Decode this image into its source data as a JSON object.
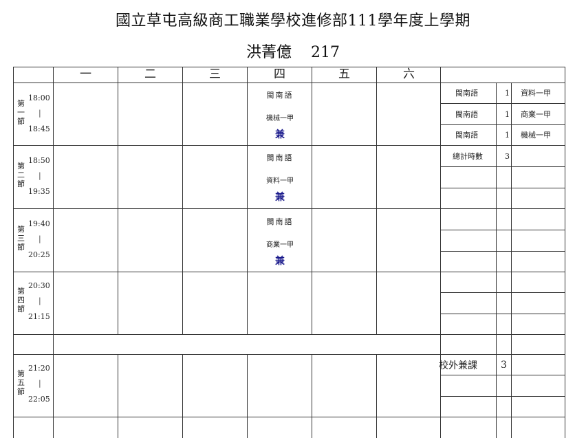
{
  "header": {
    "title": "國立草屯高級商工職業學校進修部111學年度上學期",
    "teacher": "洪菁億",
    "room": "217"
  },
  "days": [
    "一",
    "二",
    "三",
    "四",
    "五",
    "六"
  ],
  "periods": [
    {
      "chars": [
        "第",
        "一",
        "節"
      ],
      "start": "18:00",
      "end": "18:45"
    },
    {
      "chars": [
        "第",
        "二",
        "節"
      ],
      "start": "18:50",
      "end": "19:35"
    },
    {
      "chars": [
        "第",
        "三",
        "節"
      ],
      "start": "19:40",
      "end": "20:25"
    },
    {
      "chars": [
        "第",
        "四",
        "節"
      ],
      "start": "20:30",
      "end": "21:15"
    },
    {
      "chars": [
        "第",
        "五",
        "節"
      ],
      "start": "21:20",
      "end": "22:05"
    }
  ],
  "period_separator": "|",
  "courses": [
    {
      "period": 1,
      "day": "四",
      "subject": "閩南語",
      "class": "機械一甲",
      "tag": "兼"
    },
    {
      "period": 2,
      "day": "四",
      "subject": "閩南語",
      "class": "資料一甲",
      "tag": "兼"
    },
    {
      "period": 3,
      "day": "四",
      "subject": "閩南語",
      "class": "商業一甲",
      "tag": "兼"
    }
  ],
  "summary": [
    {
      "subject": "閩南語",
      "hours": "1",
      "class": "資料一甲"
    },
    {
      "subject": "閩南語",
      "hours": "1",
      "class": "商業一甲"
    },
    {
      "subject": "閩南語",
      "hours": "1",
      "class": "機械一甲"
    }
  ],
  "total": {
    "label": "總計時數",
    "value": "3"
  },
  "external": {
    "label": "校外兼課",
    "value": "3"
  }
}
